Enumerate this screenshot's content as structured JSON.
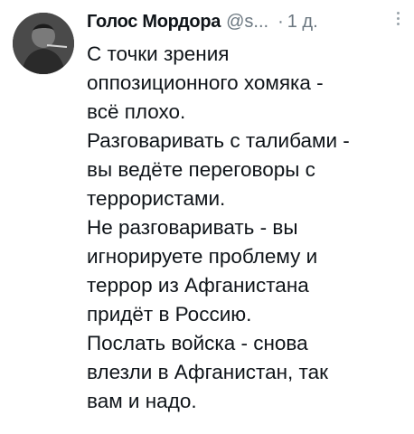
{
  "tweet": {
    "author_name": "Голос Мордора",
    "author_handle": "@s...",
    "separator": "·",
    "time": "1 д.",
    "more_icon": "more-vertical-icon",
    "lines": [
      "С точки зрения",
      "оппозиционного хомяка -",
      "всё плохо.",
      "Разговаривать с талибами -",
      "вы ведёте переговоры с",
      "террористами.",
      "Не разговаривать - вы",
      "игнорируете проблему и",
      "террор из Афганистана",
      "придёт в Россию.",
      "Послать войска - снова",
      "влезли в Афганистан, так",
      "вам и надо."
    ]
  }
}
